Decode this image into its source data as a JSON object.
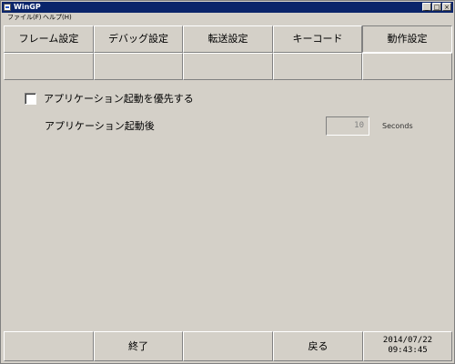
{
  "window": {
    "title": "WinGP",
    "minimize_glyph": "_",
    "maximize_glyph": "□",
    "close_glyph": "×"
  },
  "menu": {
    "items": [
      {
        "label": "ファイル(F)"
      },
      {
        "label": "ヘルプ(H)"
      }
    ]
  },
  "tabs": [
    {
      "label": "フレーム設定",
      "active": false
    },
    {
      "label": "デバッグ設定",
      "active": false
    },
    {
      "label": "転送設定",
      "active": false
    },
    {
      "label": "キーコード",
      "active": false
    },
    {
      "label": "動作設定",
      "active": true
    }
  ],
  "content": {
    "startup_priority_label": "アプリケーション起動を優先する",
    "startup_priority_checked": false,
    "delay_label": "アプリケーション起動後",
    "delay_value": "10",
    "delay_unit": "Seconds"
  },
  "bottom": {
    "exit_label": "終了",
    "back_label": "戻る",
    "date": "2014/07/22",
    "time": "09:43:45"
  },
  "colors": {
    "title_bar": "#0a246a",
    "face": "#d4d0c8"
  }
}
